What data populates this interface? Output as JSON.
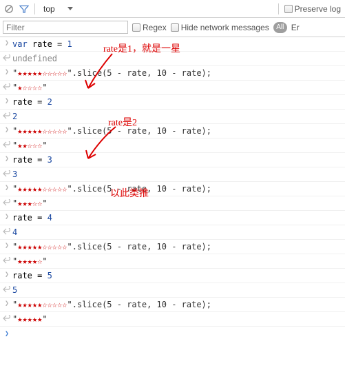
{
  "toolbar": {
    "context": "top",
    "preserve_log": "Preserve log"
  },
  "filterbar": {
    "placeholder": "Filter",
    "regex": "Regex",
    "hide": "Hide network messages",
    "all": "All",
    "err": "Er"
  },
  "lines": {
    "l0": "var rate = 1",
    "l1": "undefined",
    "l2_a": "\"★★★★★☆☆☆☆☆\"",
    "l2_b": ".slice(5 - rate, 10 - rate);",
    "l3": "\"★☆☆☆☆\"",
    "l4": "rate = 2",
    "l5": "2",
    "l6_a": "\"★★★★★☆☆☆☆☆\"",
    "l6_b": ".slice(5 - rate, 10 - rate);",
    "l7": "\"★★☆☆☆\"",
    "l8": "rate = 3",
    "l9": "3",
    "l10_a": "\"★★★★★☆☆☆☆☆\"",
    "l10_b": ".slice(5 - rate, 10 - rate);",
    "l11": "\"★★★☆☆\"",
    "l12": "rate = 4",
    "l13": "4",
    "l14_a": "\"★★★★★☆☆☆☆☆\"",
    "l14_b": ".slice(5 - rate, 10 - rate);",
    "l15": "\"★★★★☆\"",
    "l16": "rate = 5",
    "l17": "5",
    "l18_a": "\"★★★★★☆☆☆☆☆\"",
    "l18_b": ".slice(5 - rate, 10 - rate);",
    "l19": "\"★★★★★\""
  },
  "anno": {
    "a1": "rate是1，就是一星",
    "a2": "rate是2",
    "a3": "以此类推"
  }
}
